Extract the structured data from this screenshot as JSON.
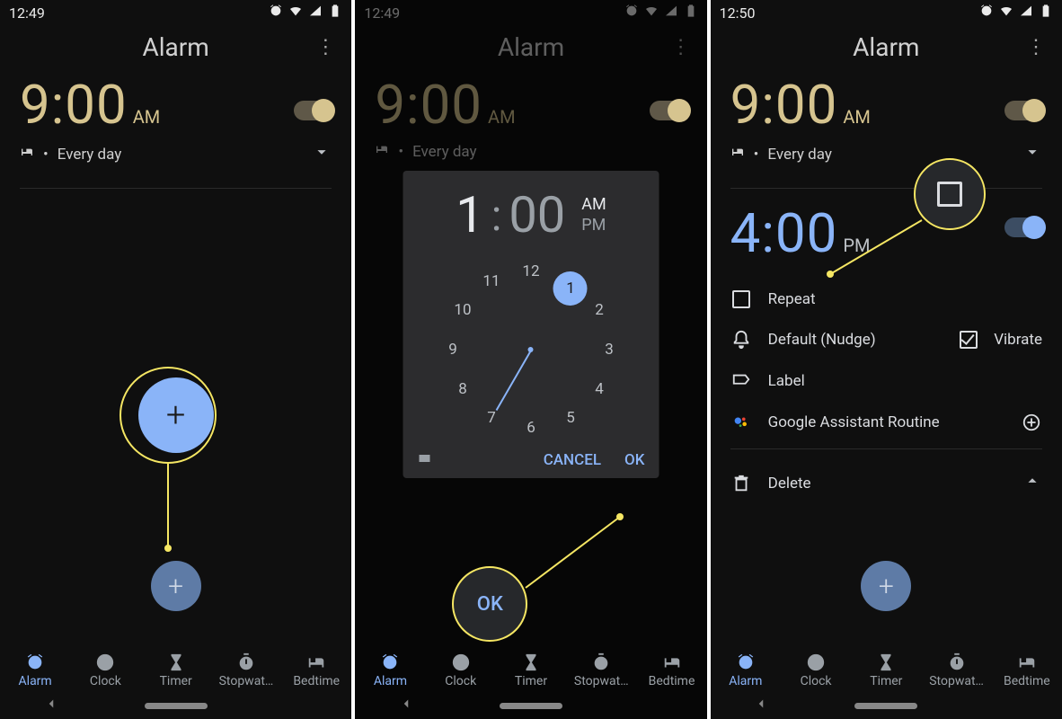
{
  "screens": [
    {
      "status": {
        "time": "12:49"
      },
      "title": "Alarm",
      "alarm": {
        "time": "9:00",
        "ampm": "AM",
        "subtitle": "Every day"
      },
      "nav": {
        "items": [
          "Alarm",
          "Clock",
          "Timer",
          "Stopwat…",
          "Bedtime"
        ],
        "active": 0
      }
    },
    {
      "status": {
        "time": "12:49"
      },
      "title": "Alarm",
      "alarm": {
        "time": "9:00",
        "ampm": "AM",
        "subtitle": "Every day"
      },
      "picker": {
        "hour": "1",
        "minute": "00",
        "am": "AM",
        "pm": "PM",
        "selected_hour": 1,
        "hours": [
          "12",
          "1",
          "2",
          "3",
          "4",
          "5",
          "6",
          "7",
          "8",
          "9",
          "10",
          "11"
        ],
        "cancel": "CANCEL",
        "ok": "OK"
      },
      "callout_ok": "OK",
      "nav": {
        "items": [
          "Alarm",
          "Clock",
          "Timer",
          "Stopwat…",
          "Bedtime"
        ],
        "active": 0
      }
    },
    {
      "status": {
        "time": "12:50"
      },
      "title": "Alarm",
      "alarm": {
        "time": "9:00",
        "ampm": "AM",
        "subtitle": "Every day"
      },
      "alarm2": {
        "time": "4:00",
        "ampm": "PM"
      },
      "opts": {
        "repeat": "Repeat",
        "sound": "Default (Nudge)",
        "vibrate": "Vibrate",
        "label": "Label",
        "routine": "Google Assistant Routine",
        "delete": "Delete"
      },
      "nav": {
        "items": [
          "Alarm",
          "Clock",
          "Timer",
          "Stopwat…",
          "Bedtime"
        ],
        "active": 0
      }
    }
  ]
}
